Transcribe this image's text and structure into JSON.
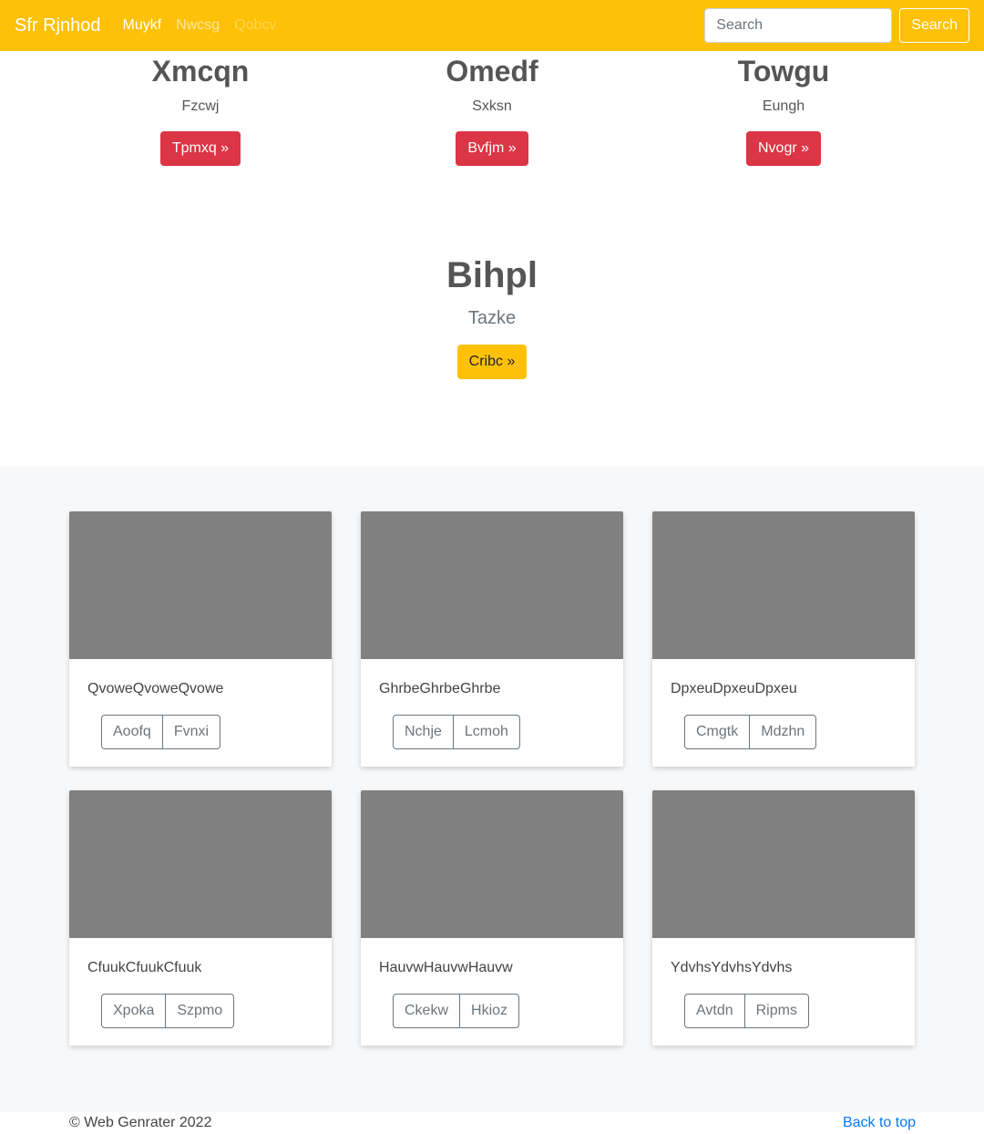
{
  "navbar": {
    "brand": "Sfr Rjnhod",
    "links": [
      {
        "label": "Muykf",
        "state": "active"
      },
      {
        "label": "Nwcsg",
        "state": "normal"
      },
      {
        "label": "Qobcv",
        "state": "disabled"
      }
    ],
    "search_placeholder": "Search",
    "search_button": "Search"
  },
  "hero_columns": [
    {
      "title": "Xmcqn",
      "subtitle": "Fzcwj",
      "button": "Tpmxq »"
    },
    {
      "title": "Omedf",
      "subtitle": "Sxksn",
      "button": "Bvfjm »"
    },
    {
      "title": "Towgu",
      "subtitle": "Eungh",
      "button": "Nvogr »"
    }
  ],
  "feature": {
    "title": "Bihpl",
    "subtitle": "Tazke",
    "button": "Cribc »"
  },
  "cards": [
    {
      "text": "QvoweQvoweQvowe",
      "buttons": [
        "Aoofq",
        "Fvnxi"
      ]
    },
    {
      "text": "GhrbeGhrbeGhrbe",
      "buttons": [
        "Nchje",
        "Lcmoh"
      ]
    },
    {
      "text": "DpxeuDpxeuDpxeu",
      "buttons": [
        "Cmgtk",
        "Mdzhn"
      ]
    },
    {
      "text": "CfuukCfuukCfuuk",
      "buttons": [
        "Xpoka",
        "Szpmo"
      ]
    },
    {
      "text": "HauvwHauvwHauvw",
      "buttons": [
        "Ckekw",
        "Hkioz"
      ]
    },
    {
      "text": "YdvhsYdvhsYdvhs",
      "buttons": [
        "Avtdn",
        "Ripms"
      ]
    }
  ],
  "footer": {
    "copyright": "© Web Genrater 2022",
    "back_to_top": "Back to top"
  },
  "colors": {
    "navbar": "#ffc107",
    "danger": "#dc3545",
    "link": "#007bff",
    "album_bg": "#f7f8fa",
    "placeholder_img": "#808080"
  }
}
